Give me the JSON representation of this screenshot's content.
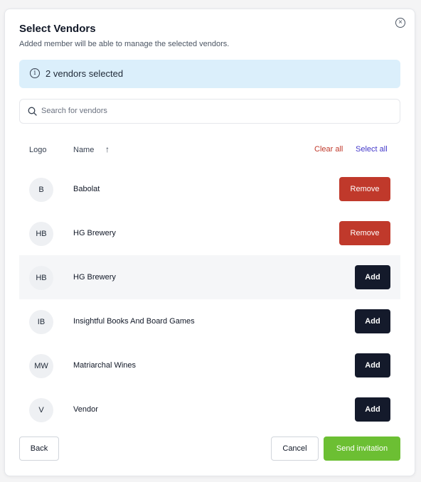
{
  "modal": {
    "title": "Select Vendors",
    "subtitle": "Added member will be able to manage the selected vendors.",
    "close_icon": "close-circle-icon"
  },
  "info_banner": {
    "icon": "info-circle-icon",
    "text": "2 vendors selected"
  },
  "search": {
    "icon": "search-icon",
    "placeholder": "Search for vendors",
    "value": ""
  },
  "table": {
    "headers": {
      "logo": "Logo",
      "name": "Name",
      "sort_icon": "↑"
    },
    "clear_all": "Clear all",
    "select_all": "Select all",
    "rows": [
      {
        "initials": "B",
        "name": "Babolat",
        "action": "Remove"
      },
      {
        "initials": "HB",
        "name": "HG Brewery",
        "action": "Remove"
      },
      {
        "initials": "HB",
        "name": "HG Brewery",
        "action": "Add"
      },
      {
        "initials": "IB",
        "name": "Insightful Books And Board Games",
        "action": "Add"
      },
      {
        "initials": "MW",
        "name": "Matriarchal Wines",
        "action": "Add"
      },
      {
        "initials": "V",
        "name": "Vendor",
        "action": "Add"
      }
    ]
  },
  "footer": {
    "back": "Back",
    "cancel": "Cancel",
    "send": "Send invitation"
  },
  "colors": {
    "remove": "#c0392b",
    "add": "#141a2b",
    "send": "#6cbf33",
    "banner": "#dbeffb",
    "select_all": "#4338ca"
  }
}
